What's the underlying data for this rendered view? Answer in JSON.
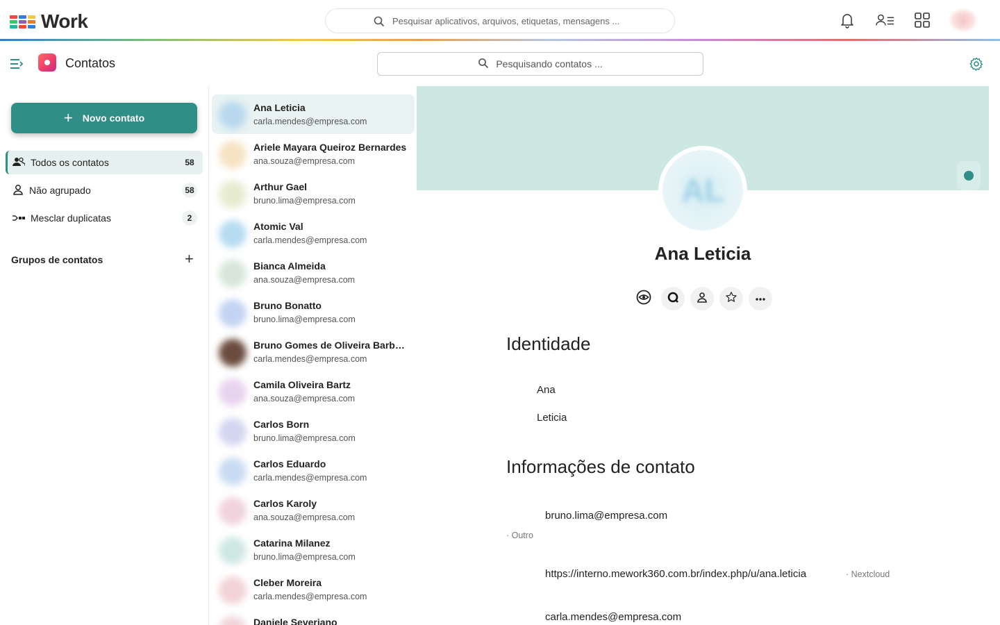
{
  "topbar": {
    "brand": "Work",
    "search_placeholder": "Pesquisar aplicativos, arquivos, etiquetas, mensagens ...",
    "logo_colors": [
      "#e74c3c",
      "#3a7bd5",
      "#f2c84b",
      "#2ecc71",
      "#9b59b6",
      "#e67e22",
      "#1abc9c",
      "#e74c3c",
      "#3a7bd5"
    ],
    "icons": [
      "bell-icon",
      "contacts-menu-icon",
      "apps-grid-icon",
      "user-avatar"
    ]
  },
  "app": {
    "title": "Contatos",
    "search_placeholder": "Pesquisando contatos ...",
    "accent": "#2f8f86"
  },
  "nav": {
    "new_contact": "Novo contato",
    "items": [
      {
        "label": "Todos os contatos",
        "count": "58",
        "icon": "people-icon"
      },
      {
        "label": "Não agrupado",
        "count": "58",
        "icon": "person-icon"
      },
      {
        "label": "Mesclar duplicatas",
        "count": "2",
        "icon": "merge-icon"
      }
    ],
    "groups_title": "Grupos de contatos"
  },
  "contacts": [
    {
      "name": "Ana Leticia",
      "email": "carla.mendes@empresa.com",
      "color": "#b9d8ee"
    },
    {
      "name": "Ariele Mayara Queiroz Bernardes",
      "email": "ana.souza@empresa.com",
      "color": "#f5e3c3"
    },
    {
      "name": "Arthur Gael",
      "email": "bruno.lima@empresa.com",
      "color": "#e7ecd0"
    },
    {
      "name": "Atomic Val",
      "email": "carla.mendes@empresa.com",
      "color": "#b7dcf2"
    },
    {
      "name": "Bianca Almeida",
      "email": "ana.souza@empresa.com",
      "color": "#d7e6d9"
    },
    {
      "name": "Bruno Bonatto",
      "email": "bruno.lima@empresa.com",
      "color": "#c3d3f2"
    },
    {
      "name": "Bruno Gomes de Oliveira Barbosa",
      "email": "carla.mendes@empresa.com",
      "color": "#6b4b3e"
    },
    {
      "name": "Camila Oliveira Bartz",
      "email": "ana.souza@empresa.com",
      "color": "#e8d3ee"
    },
    {
      "name": "Carlos Born",
      "email": "bruno.lima@empresa.com",
      "color": "#d3d6f0"
    },
    {
      "name": "Carlos Eduardo",
      "email": "carla.mendes@empresa.com",
      "color": "#c9dbf2"
    },
    {
      "name": "Carlos Karoly",
      "email": "ana.souza@empresa.com",
      "color": "#f1d3dc"
    },
    {
      "name": "Catarina Milanez",
      "email": "bruno.lima@empresa.com",
      "color": "#cfe8e4"
    },
    {
      "name": "Cleber Moreira",
      "email": "carla.mendes@empresa.com",
      "color": "#f2d3d6"
    },
    {
      "name": "Daniele Severiano",
      "email": "",
      "color": "#f0d6dc"
    }
  ],
  "detail": {
    "initials": "AL",
    "name": "Ana Leticia",
    "identity_title": "Identidade",
    "first_name": "Ana",
    "last_name": "Leticia",
    "contact_title": "Informações de contato",
    "email1": "bruno.lima@empresa.com",
    "email1_type": "· Outro",
    "url": "https://interno.mework360.com.br/index.php/u/ana.leticia",
    "url_type": "· Nextcloud",
    "email2": "carla.mendes@empresa.com",
    "action_icons": [
      "eye-icon",
      "talk-icon",
      "person-icon",
      "star-icon",
      "more-icon"
    ]
  }
}
